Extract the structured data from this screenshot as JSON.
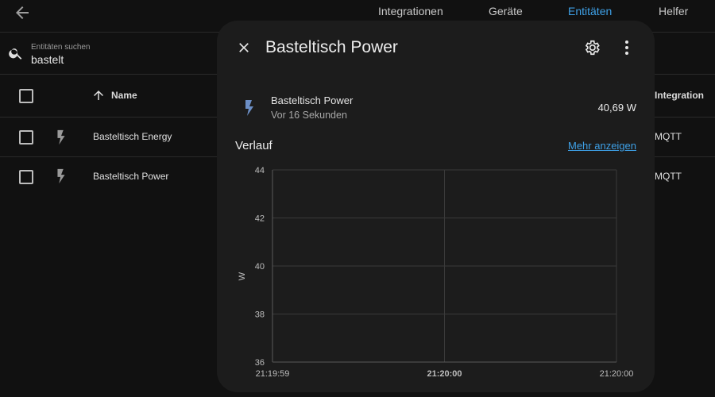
{
  "topbar": {
    "tabs": [
      {
        "label": "Integrationen",
        "active": false
      },
      {
        "label": "Geräte",
        "active": false
      },
      {
        "label": "Entitäten",
        "active": true
      },
      {
        "label": "Helfer",
        "active": false
      }
    ]
  },
  "search": {
    "label": "Entitäten suchen",
    "value": "bastelt"
  },
  "table": {
    "columns": {
      "name": "Name",
      "integration": "Integration"
    },
    "rows": [
      {
        "name": "Basteltisch Energy",
        "integration": "MQTT",
        "icon": "flash-icon"
      },
      {
        "name": "Basteltisch Power",
        "integration": "MQTT",
        "icon": "flash-icon"
      }
    ]
  },
  "dialog": {
    "title": "Basteltisch Power",
    "entity": {
      "name": "Basteltisch Power",
      "last_changed": "Vor 16 Sekunden",
      "value": "40,69 W",
      "icon": "flash-icon"
    },
    "history_title": "Verlauf",
    "more_link": "Mehr anzeigen"
  },
  "colors": {
    "accent": "#3ea0e6",
    "dialog_bg": "#1c1c1c",
    "page_bg": "#111111"
  },
  "chart_data": {
    "type": "line",
    "ylabel": "W",
    "ylim": [
      36,
      44
    ],
    "yticks": [
      "36",
      "38",
      "40",
      "42",
      "44"
    ],
    "xticks": [
      {
        "label": "21:19:59",
        "bold": false
      },
      {
        "label": "21:20:00",
        "bold": true
      },
      {
        "label": "21:20:00",
        "bold": false
      }
    ],
    "series": []
  }
}
